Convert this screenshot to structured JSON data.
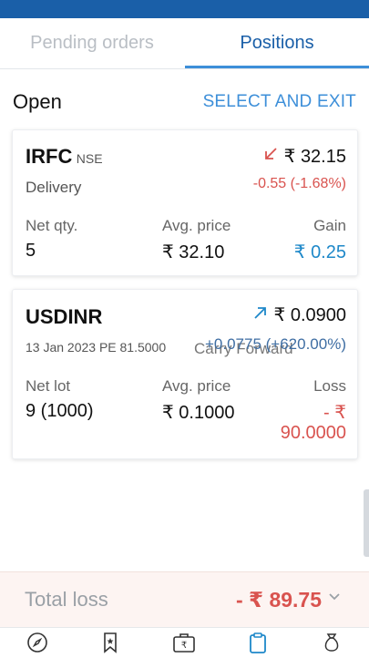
{
  "tabs": [
    {
      "label": "Pending orders",
      "active": false
    },
    {
      "label": "Positions",
      "active": true
    }
  ],
  "section": {
    "title": "Open",
    "action": "SELECT AND EXIT"
  },
  "positions": [
    {
      "symbol": "IRFC",
      "exchange": "NSE",
      "product": "Delivery",
      "ltp": "₹ 32.15",
      "direction": "down",
      "change": "-0.55 (-1.68%)",
      "qty_label": "Net qty.",
      "qty": "5",
      "avg_label": "Avg. price",
      "avg": "₹ 32.10",
      "pnl_label": "Gain",
      "pnl": "₹ 0.25"
    },
    {
      "symbol": "USDINR",
      "contract": "13 Jan 2023 PE 81.5000",
      "product": "Carry Forward",
      "ltp": "₹ 0.0900",
      "direction": "up",
      "change": "+0.0775 (+620.00%)",
      "qty_label": "Net lot",
      "qty": "9 (1000)",
      "avg_label": "Avg. price",
      "avg": "₹ 0.1000",
      "pnl_label": "Loss",
      "pnl_line1": "- ₹",
      "pnl_line2": "90.0000"
    }
  ],
  "summary": {
    "label": "Total loss",
    "value": "- ₹ 89.75"
  },
  "nav": [
    {
      "icon": "compass-icon"
    },
    {
      "icon": "bookmark-star-icon"
    },
    {
      "icon": "briefcase-rupee-icon"
    },
    {
      "icon": "clipboard-icon",
      "active": true
    },
    {
      "icon": "money-bag-icon"
    }
  ],
  "colors": {
    "primary": "#1a5fa8",
    "accent": "#3d8fd9",
    "loss": "#d9534f",
    "gain": "#1e88c9"
  }
}
